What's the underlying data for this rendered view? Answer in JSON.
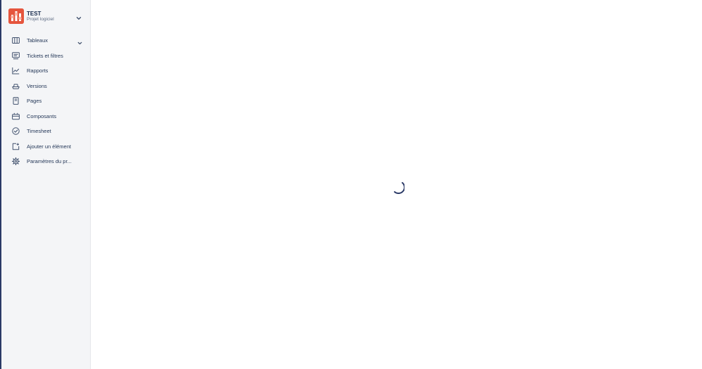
{
  "project": {
    "name": "TEST",
    "type": "Projet logiciel",
    "avatar_color": "#e5553d"
  },
  "sidebar": {
    "items": [
      {
        "label": "Tableaux",
        "icon": "board-icon",
        "has_chevron": true
      },
      {
        "label": "Tickets et filtres",
        "icon": "issues-filter-icon"
      },
      {
        "label": "Rapports",
        "icon": "reports-chart-icon"
      },
      {
        "label": "Versions",
        "icon": "ship-icon"
      },
      {
        "label": "Pages",
        "icon": "page-icon"
      },
      {
        "label": "Composants",
        "icon": "component-icon"
      },
      {
        "label": "Timesheet",
        "icon": "check-circle-icon"
      },
      {
        "label": "Ajouter un élément",
        "icon": "add-item-icon"
      },
      {
        "label": "Paramètres du pr...",
        "icon": "settings-gear-icon"
      }
    ]
  },
  "main": {
    "state": "loading",
    "spinner_color": "#2b3a67"
  },
  "colors": {
    "sidebar_bg": "#f4f5f7",
    "text": "#172b4d",
    "subtext": "#5e6c84",
    "edge": "#2b3a67"
  }
}
